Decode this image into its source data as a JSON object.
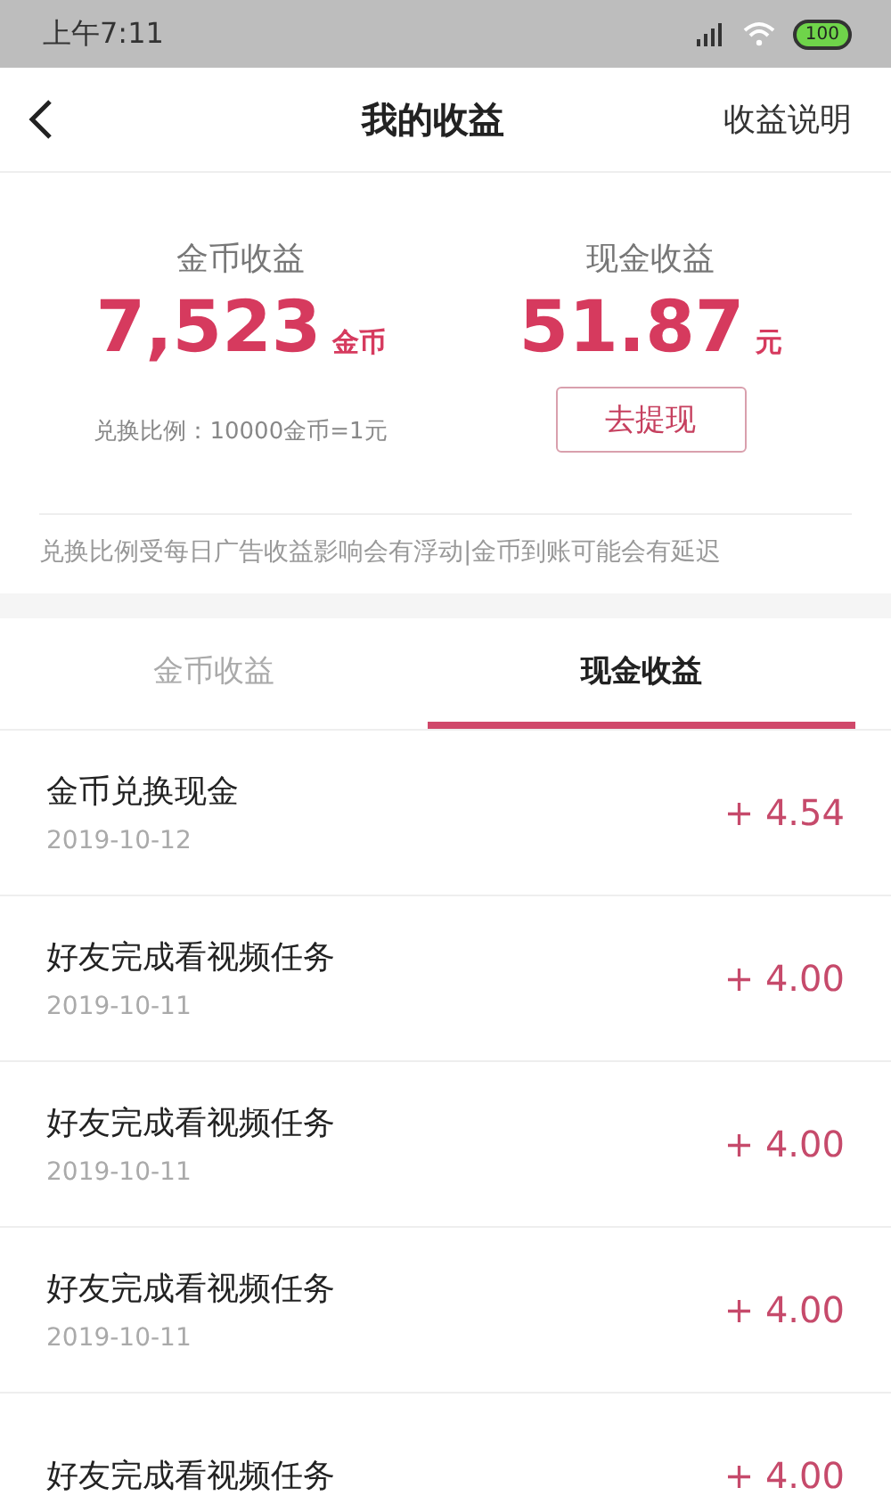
{
  "status_bar": {
    "time": "上午7:11",
    "battery": "100"
  },
  "nav": {
    "title": "我的收益",
    "action": "收益说明"
  },
  "summary": [
    {
      "label": "金币收益",
      "value": "7,523",
      "unit": "金币",
      "note": "兑换比例：10000金币=1元",
      "kind": "note"
    },
    {
      "label": "现金收益",
      "value": "51.87",
      "unit": "元",
      "button": "去提现",
      "kind": "button"
    }
  ],
  "notice": "兑换比例受每日广告收益影响会有浮动|金币到账可能会有延迟",
  "tabs": [
    {
      "label": "金币收益",
      "selected": false
    },
    {
      "label": "现金收益",
      "selected": true
    }
  ],
  "records": [
    {
      "title": "金币兑换现金",
      "date": "2019-10-12",
      "amount": "+ 4.54"
    },
    {
      "title": "好友完成看视频任务",
      "date": "2019-10-11",
      "amount": "+ 4.00"
    },
    {
      "title": "好友完成看视频任务",
      "date": "2019-10-11",
      "amount": "+ 4.00"
    },
    {
      "title": "好友完成看视频任务",
      "date": "2019-10-11",
      "amount": "+ 4.00"
    },
    {
      "title": "好友完成看视频任务",
      "amount": "+ 4.00"
    }
  ]
}
